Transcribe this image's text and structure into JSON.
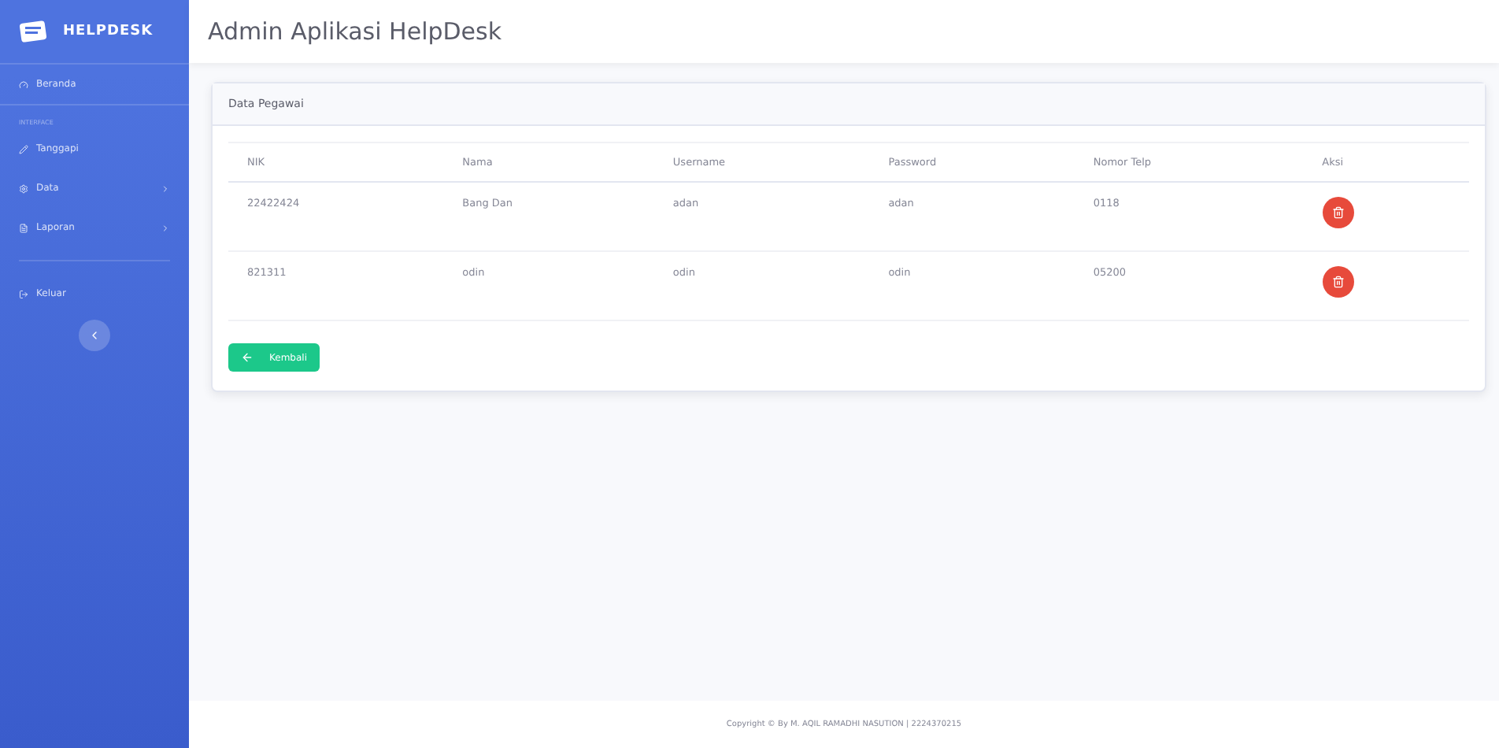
{
  "brand": "HELPDESK",
  "sidebar": {
    "items": [
      {
        "kind": "link",
        "label": "Beranda",
        "arrow": false
      },
      {
        "kind": "heading",
        "label": "INTERFACE"
      },
      {
        "kind": "link",
        "label": "Tanggapi",
        "arrow": false
      },
      {
        "kind": "link",
        "label": "Data",
        "arrow": true
      },
      {
        "kind": "link",
        "label": "Laporan",
        "arrow": true
      },
      {
        "kind": "divider"
      },
      {
        "kind": "link",
        "label": "Keluar",
        "arrow": false
      }
    ]
  },
  "page_title": "Admin Aplikasi HelpDesk",
  "card": {
    "title": "Data Pegawai",
    "table": {
      "columns": [
        "NIK",
        "Nama",
        "Username",
        "Password",
        "Nomor Telp",
        "Aksi"
      ],
      "rows": [
        [
          "22422424",
          "Bang Dan",
          "adan",
          "adan",
          "0118"
        ],
        [
          "821311",
          "odin",
          "odin",
          "odin",
          "05200"
        ]
      ]
    },
    "back_button": "Kembali"
  },
  "footer": "Copyright © By M. AQIL RAMADHI NASUTION | 2224370215"
}
